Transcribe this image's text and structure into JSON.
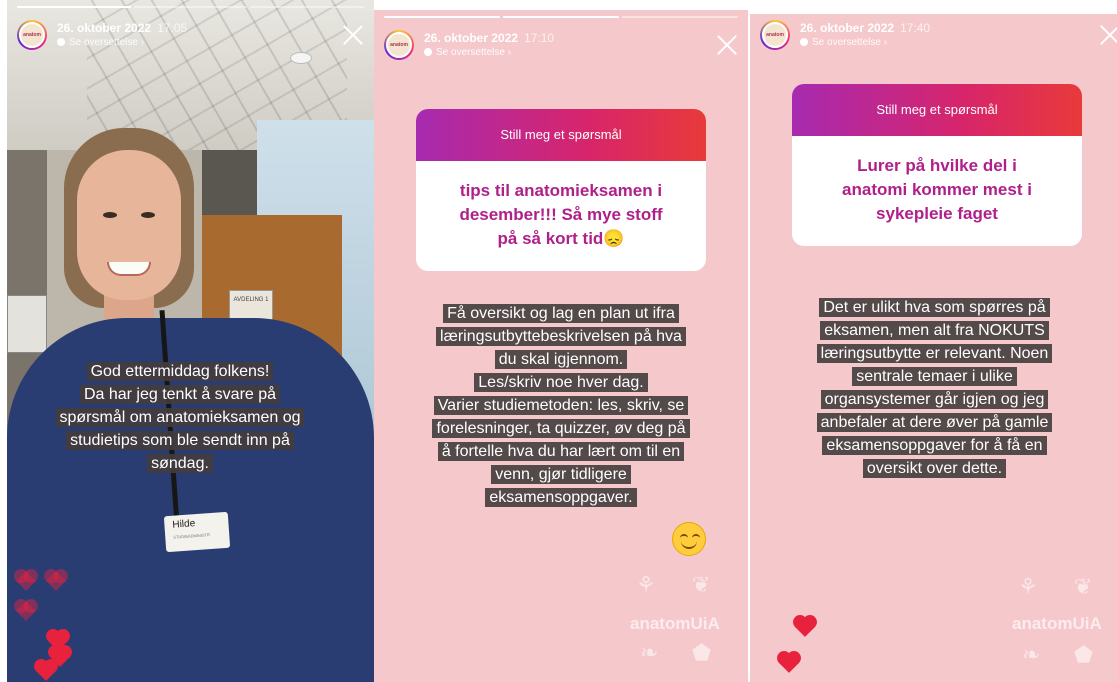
{
  "stories": [
    {
      "date": "26. oktober 2022",
      "time": "17:05",
      "translate_label": "Se oversettelse",
      "caption_lines": [
        "God ettermiddag folkens!",
        "Da har jeg tenkt å svare på",
        "spørsmål om anatomieksamen og",
        "studietips  som ble sendt inn på",
        "søndag."
      ],
      "badge_name": "Hilde",
      "badge_sub": "STUDIEADMINISTR",
      "door_sign": "AVDELING 1"
    },
    {
      "date": "26. oktober 2022",
      "time": "17:10",
      "translate_label": "Se oversettelse",
      "question_header": "Still meg et spørsmål",
      "question_lines": [
        "tips til anatomieksamen i",
        "desember!!! Så mye stoff",
        "på så kort tid😞"
      ],
      "answer_lines": [
        "Få oversikt og lag en plan ut ifra",
        "læringsutbyttebeskrivelsen på hva",
        "du skal igjennom.",
        "Les/skriv noe hver dag.",
        "Varier studiemetoden: les, skriv, se",
        "forelesninger, ta quizzer, øv deg på",
        "å fortelle hva du har lært om til en",
        "venn, gjør tidligere",
        "eksamensoppgaver."
      ],
      "watermark": "anatomUiA"
    },
    {
      "date": "26. oktober 2022",
      "time": "17:40",
      "translate_label": "Se oversettelse",
      "question_header": "Still meg et spørsmål",
      "question_lines": [
        "Lurer på hvilke del i",
        "anatomi kommer mest i",
        "sykepleie faget"
      ],
      "answer_lines": [
        "Det er ulikt hva som spørres på",
        "eksamen, men alt fra NOKUTS",
        "læringsutbytte er relevant. Noen",
        "sentrale temaer i ulike",
        "organsystemer går igjen og jeg",
        "anbefaler at dere øver på gamle",
        "eksamensoppgaver for å få en",
        "oversikt over dette."
      ],
      "watermark": "anatomUiA"
    }
  ],
  "colors": {
    "story_bg": "#f5c8cc",
    "question_text": "#b0208a",
    "heart": "#e8213d"
  },
  "icons": [
    "close-icon",
    "heart-icon",
    "avatar",
    "smiley-emoji",
    "lungs-icon",
    "kidney-icon",
    "stomach-icon",
    "liver-icon"
  ]
}
